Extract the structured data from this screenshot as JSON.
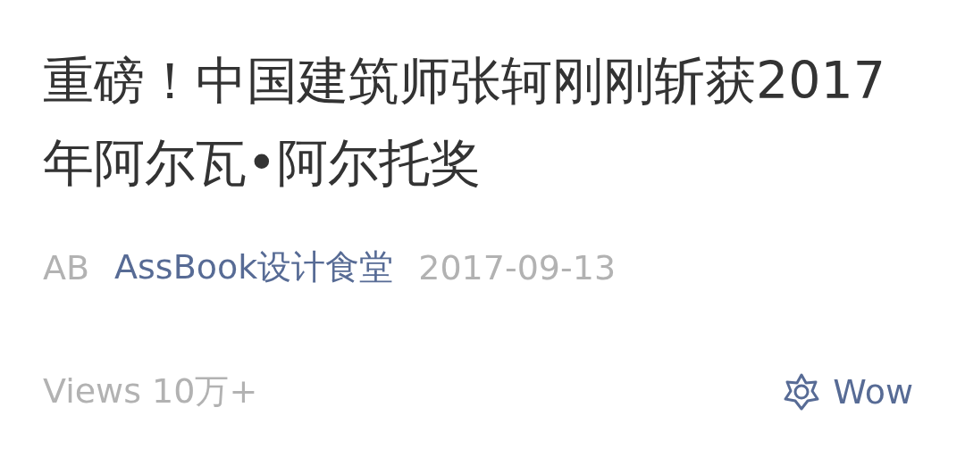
{
  "article": {
    "title": "重磅！中国建筑师张轲刚刚斩获2017年阿尔瓦•阿尔托奖",
    "meta": {
      "author": "AB",
      "account": "AssBook设计食堂",
      "date": "2017-09-13"
    },
    "footer": {
      "views": "Views 10万+",
      "wow": "Wow"
    }
  }
}
